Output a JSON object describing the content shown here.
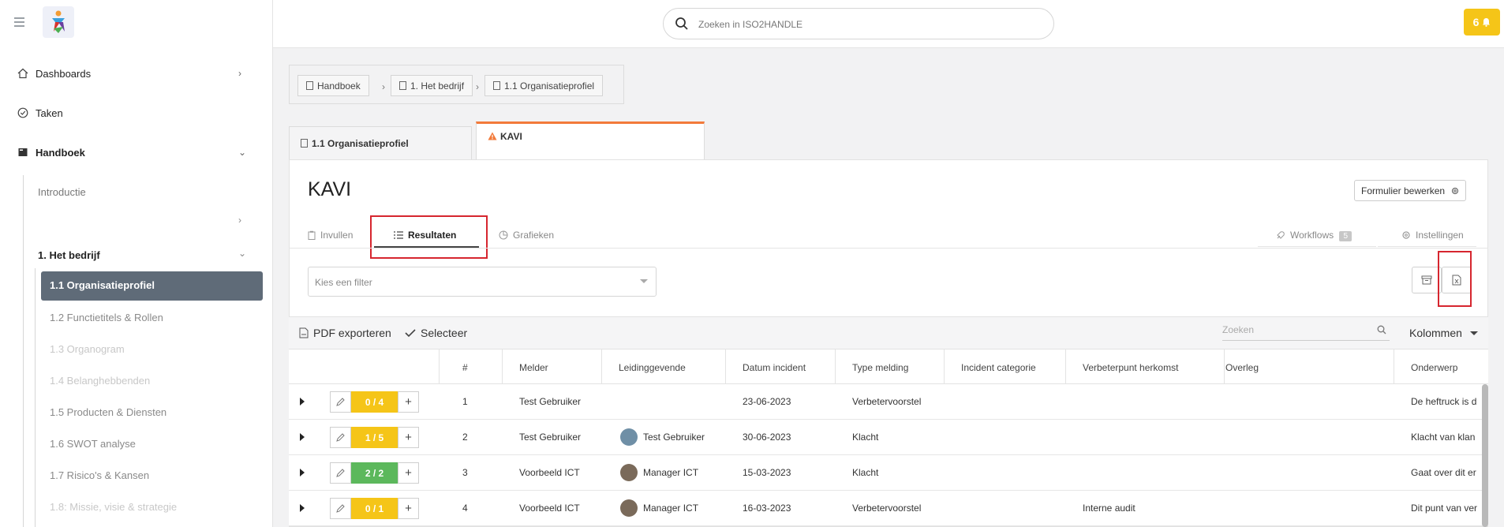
{
  "header": {
    "search_placeholder": "Zoeken in ISO2HANDLE",
    "notification_count": "6"
  },
  "sidebar": {
    "items": [
      {
        "label": "Dashboards"
      },
      {
        "label": "Taken"
      },
      {
        "label": "Handboek"
      }
    ],
    "handboek_children": [
      "Introductie",
      "1. Het bedrijf"
    ],
    "bedrijf_children": [
      "1.1 Organisatieprofiel",
      "1.2 Functietitels & Rollen",
      "1.3 Organogram",
      "1.4 Belanghebbenden",
      "1.5 Producten & Diensten",
      "1.6 SWOT analyse",
      "1.7 Risico's & Kansen",
      "1.8: Missie, visie & strategie"
    ]
  },
  "breadcrumb": [
    "Handboek",
    "1. Het bedrijf",
    "1.1 Organisatieprofiel"
  ],
  "doc_tabs": [
    "1.1 Organisatieprofiel",
    "KAVI"
  ],
  "page": {
    "title": "KAVI",
    "edit_form_label": "Formulier bewerken",
    "subtabs": [
      "Invullen",
      "Resultaten",
      "Grafieken"
    ],
    "workflows_label": "Workflows",
    "workflows_count": "5",
    "settings_label": "Instellingen",
    "filter_placeholder": "Kies een filter"
  },
  "toolbar": {
    "pdf_export": "PDF exporteren",
    "select": "Selecteer",
    "search_placeholder": "Zoeken",
    "columns": "Kolommen"
  },
  "table": {
    "headers": [
      "#",
      "Melder",
      "Leidinggevende",
      "Datum incident",
      "Type melding",
      "Incident categorie",
      "Verbeterpunt herkomst",
      "Overleg",
      "Onderwerp"
    ],
    "rows": [
      {
        "progress": "0 / 4",
        "progress_color": "#f5c518",
        "num": "1",
        "melder": "Test Gebruiker",
        "leiding": "",
        "datum": "23-06-2023",
        "type": "Verbetervoorstel",
        "herkomst": "",
        "onderwerp": "De heftruck is d"
      },
      {
        "progress": "1 / 5",
        "progress_color": "#f5c518",
        "num": "2",
        "melder": "Test Gebruiker",
        "leiding": "Test Gebruiker",
        "datum": "30-06-2023",
        "type": "Klacht",
        "herkomst": "",
        "onderwerp": "Klacht van klan"
      },
      {
        "progress": "2 / 2",
        "progress_color": "#5cb85c",
        "num": "3",
        "melder": "Voorbeeld ICT",
        "leiding": "Manager ICT",
        "datum": "15-03-2023",
        "type": "Klacht",
        "herkomst": "",
        "onderwerp": "Gaat over dit er"
      },
      {
        "progress": "0 / 1",
        "progress_color": "#f5c518",
        "num": "4",
        "melder": "Voorbeeld ICT",
        "leiding": "Manager ICT",
        "datum": "16-03-2023",
        "type": "Verbetervoorstel",
        "herkomst": "Interne audit",
        "onderwerp": "Dit punt van ver"
      }
    ]
  },
  "colors": {
    "accent_tab": "#f27a3a",
    "active_nav": "#5f6b78",
    "notification": "#f5c518",
    "highlight": "#d6262f"
  }
}
